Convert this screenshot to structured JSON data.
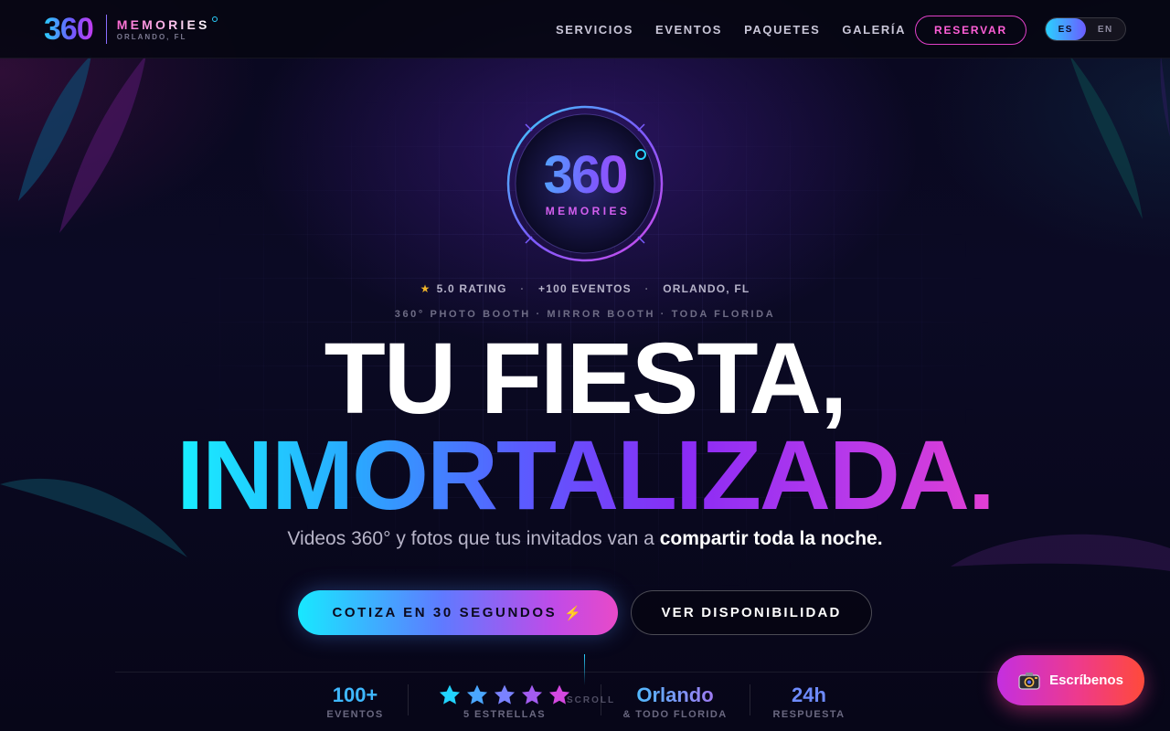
{
  "brand": {
    "logo_text": "360",
    "name": "MEMORIES",
    "location": "ORLANDO, FL"
  },
  "nav": {
    "items": [
      {
        "label": "SERVICIOS"
      },
      {
        "label": "EVENTOS"
      },
      {
        "label": "PAQUETES"
      },
      {
        "label": "GALERÍA"
      }
    ],
    "reserve_label": "RESERVAR",
    "languages": [
      {
        "label": "ES",
        "active": true
      },
      {
        "label": "EN",
        "active": false
      }
    ]
  },
  "hero": {
    "logo_number": "360",
    "logo_subtitle": "MEMORIES",
    "badges": {
      "rating": "5.0 RATING",
      "events": "+100 EVENTOS",
      "location": "ORLANDO, FL"
    },
    "services_line": "360° PHOTO BOOTH · MIRROR BOOTH · TODA FLORIDA",
    "headline_line1": "TU FIESTA,",
    "headline_line2": "INMORTALIZADA.",
    "tagline_start": "Videos 360° y fotos que tus invitados van a ",
    "tagline_bold": "compartir toda la noche.",
    "cta_primary": "COTIZA EN 30 SEGUNDOS",
    "cta_primary_icon": "⚡",
    "cta_secondary": "VER DISPONIBILIDAD",
    "scroll_label": "SCROLL"
  },
  "stats": [
    {
      "value": "100+",
      "label": "EVENTOS",
      "color": "#3fb8ff"
    },
    {
      "value": "★★★★★",
      "label": "5 ESTRELLAS",
      "stars": 5
    },
    {
      "value": "Orlando",
      "label": "& TODO FLORIDA",
      "color": "#9a6bff"
    },
    {
      "value": "24h",
      "label": "RESPUESTA",
      "color": "#6e8bff"
    }
  ],
  "chat_button": {
    "label": "Escríbenos",
    "icon": "camera-icon"
  },
  "colors": {
    "accent_cyan": "#18f0ff",
    "accent_violet": "#8a2cf5",
    "accent_pink": "#e23fd4",
    "background": "#07061a"
  }
}
